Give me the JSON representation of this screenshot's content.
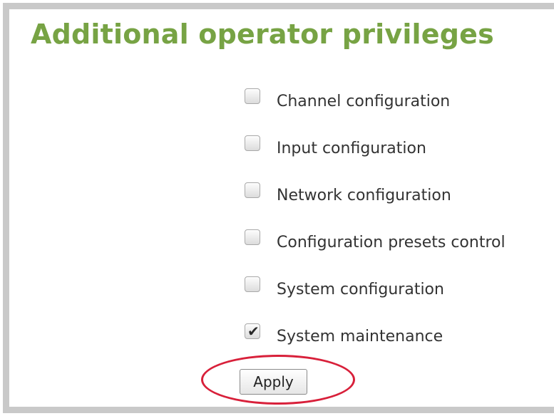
{
  "page": {
    "title": "Additional operator privileges"
  },
  "privileges": [
    {
      "label": "Channel configuration",
      "checked": false
    },
    {
      "label": "Input configuration",
      "checked": false
    },
    {
      "label": "Network configuration",
      "checked": false
    },
    {
      "label": "Configuration presets control",
      "checked": false
    },
    {
      "label": "System configuration",
      "checked": false
    },
    {
      "label": "System maintenance",
      "checked": true
    }
  ],
  "actions": {
    "apply_label": "Apply"
  },
  "annotation": {
    "highlight_color": "#d8203a"
  },
  "colors": {
    "title": "#77a344",
    "frame_border": "#c9c9c9"
  }
}
